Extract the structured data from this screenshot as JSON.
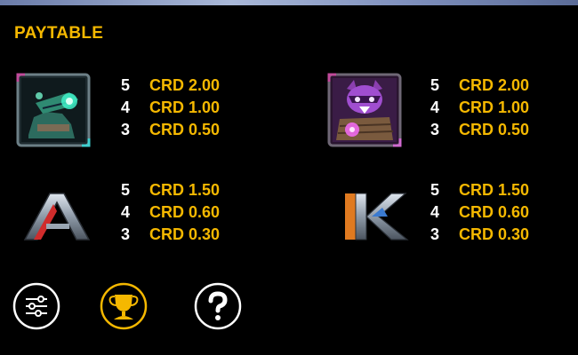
{
  "title": "PAYTABLE",
  "colors": {
    "accent": "#f5b800",
    "text": "#ffffff",
    "background": "#000000"
  },
  "symbols": [
    {
      "icon": "crocodile-warrior-icon",
      "pays": [
        {
          "count": "5",
          "amount": "CRD 2.00"
        },
        {
          "count": "4",
          "amount": "CRD 1.00"
        },
        {
          "count": "3",
          "amount": "CRD 0.50"
        }
      ]
    },
    {
      "icon": "raccoon-warrior-icon",
      "pays": [
        {
          "count": "5",
          "amount": "CRD 2.00"
        },
        {
          "count": "4",
          "amount": "CRD 1.00"
        },
        {
          "count": "3",
          "amount": "CRD 0.50"
        }
      ]
    },
    {
      "icon": "letter-a-icon",
      "pays": [
        {
          "count": "5",
          "amount": "CRD 1.50"
        },
        {
          "count": "4",
          "amount": "CRD 0.60"
        },
        {
          "count": "3",
          "amount": "CRD 0.30"
        }
      ]
    },
    {
      "icon": "letter-k-icon",
      "pays": [
        {
          "count": "5",
          "amount": "CRD 1.50"
        },
        {
          "count": "4",
          "amount": "CRD 0.60"
        },
        {
          "count": "3",
          "amount": "CRD 0.30"
        }
      ]
    }
  ],
  "bottom_buttons": [
    {
      "icon": "settings-sliders-icon"
    },
    {
      "icon": "trophy-paytable-icon",
      "active": true
    },
    {
      "icon": "help-icon"
    }
  ]
}
